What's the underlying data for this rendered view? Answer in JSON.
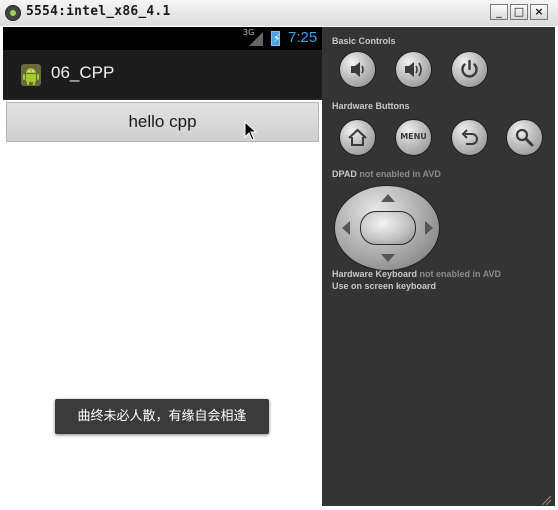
{
  "window": {
    "title": "5554:intel_x86_4.1",
    "min_label": "_",
    "max_label": "□",
    "close_label": "×"
  },
  "statusbar": {
    "network": "3G",
    "time": "7:25"
  },
  "actionbar": {
    "app_title": "06_CPP"
  },
  "content": {
    "hello_button_label": "hello cpp"
  },
  "toast": {
    "message": "曲终未必人散，有缘自会相逢"
  },
  "panel": {
    "basic_controls_title": "Basic Controls",
    "hardware_buttons_title": "Hardware Buttons",
    "menu_label": "MENU",
    "dpad_title": "DPAD",
    "dpad_note": " not enabled in AVD",
    "keyboard_title": "Hardware Keyboard",
    "keyboard_note": " not enabled in AVD",
    "onscreen_keyboard": "Use on screen keyboard"
  },
  "icons": [
    "android-app-icon",
    "volume-down-icon",
    "volume-up-icon",
    "power-icon",
    "home-icon",
    "menu-icon",
    "back-icon",
    "search-icon",
    "dpad-icon",
    "mouse-cursor-icon"
  ],
  "colors": {
    "clock": "#3aa7e6",
    "panel": "#343434",
    "toast": "#3b3b3b"
  }
}
